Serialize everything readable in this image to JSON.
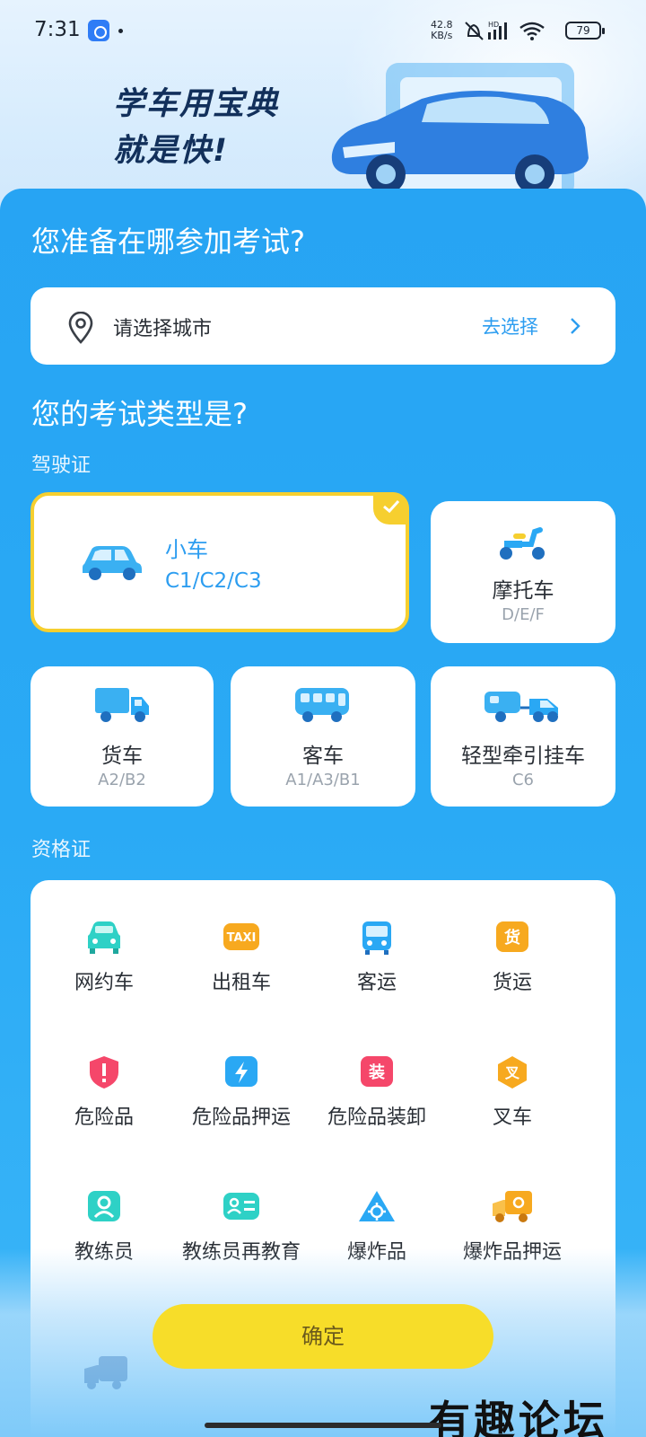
{
  "status_bar": {
    "time": "7:31",
    "net_speed": "42.8",
    "net_unit": "KB/s",
    "battery": "79",
    "icons": [
      "app-notification-icon",
      "mute-icon",
      "hd-signal-icon",
      "wifi-icon",
      "battery-icon"
    ]
  },
  "hero": {
    "slogan_line1": "学车用宝典",
    "slogan_line2": "就是快!"
  },
  "city": {
    "question": "您准备在哪参加考试?",
    "placeholder": "请选择城市",
    "action": "去选择"
  },
  "exam_type": {
    "question": "您的考试类型是?",
    "license_section": "驾驶证",
    "licenses": [
      {
        "name": "小车",
        "code": "C1/C2/C3",
        "selected": true,
        "icon": "car-icon"
      },
      {
        "name": "摩托车",
        "code": "D/E/F",
        "selected": false,
        "icon": "scooter-icon"
      },
      {
        "name": "货车",
        "code": "A2/B2",
        "selected": false,
        "icon": "truck-icon"
      },
      {
        "name": "客车",
        "code": "A1/A3/B1",
        "selected": false,
        "icon": "bus-icon"
      },
      {
        "name": "轻型牵引挂车",
        "code": "C6",
        "selected": false,
        "icon": "trailer-icon"
      }
    ],
    "qualification_section": "资格证",
    "qualifications": [
      {
        "label": "网约车",
        "icon": "ride-hailing-car-icon"
      },
      {
        "label": "出租车",
        "icon": "taxi-icon",
        "icon_text": "TAXI"
      },
      {
        "label": "客运",
        "icon": "passenger-bus-icon"
      },
      {
        "label": "货运",
        "icon": "freight-icon",
        "icon_text": "货"
      },
      {
        "label": "危险品",
        "icon": "hazard-shield-icon"
      },
      {
        "label": "危险品押运",
        "icon": "lightning-icon"
      },
      {
        "label": "危险品装卸",
        "icon": "loading-icon",
        "icon_text": "装"
      },
      {
        "label": "叉车",
        "icon": "forklift-icon",
        "icon_text": "叉"
      },
      {
        "label": "教练员",
        "icon": "coach-icon"
      },
      {
        "label": "教练员再教育",
        "icon": "coach-card-icon"
      },
      {
        "label": "爆炸品",
        "icon": "explosive-icon"
      },
      {
        "label": "爆炸品押运",
        "icon": "explosive-truck-icon"
      }
    ]
  },
  "confirm_label": "确定",
  "watermark": "有趣论坛",
  "colors": {
    "panel_blue": "#2aa8f4",
    "accent_yellow": "#f7dd29",
    "selected_border": "#f6cf2f",
    "link_blue": "#2c9df0"
  }
}
